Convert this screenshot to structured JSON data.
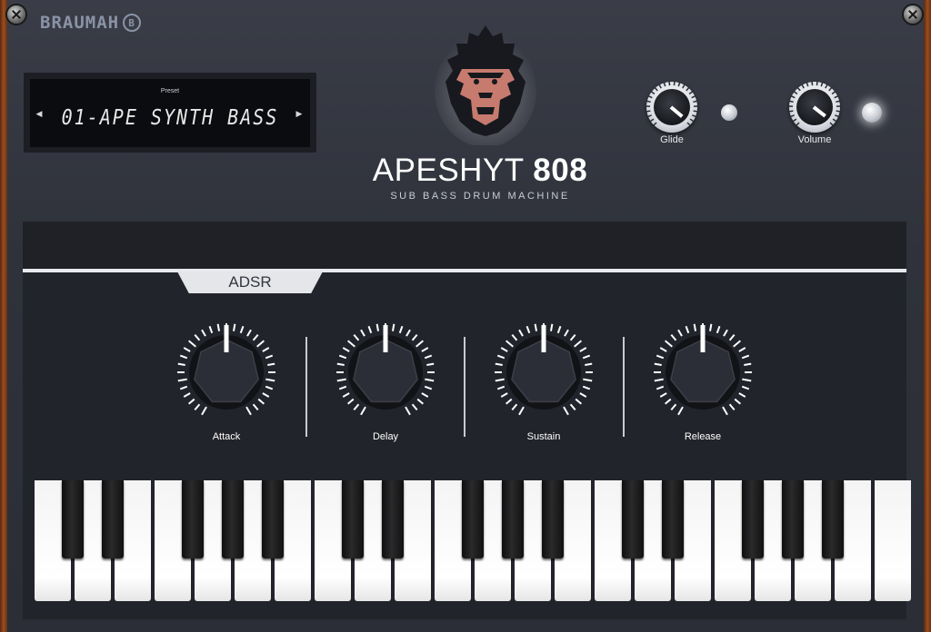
{
  "brand": {
    "name": "BRAUMAH",
    "badge": "B"
  },
  "preset": {
    "label": "Preset",
    "name": "01-APE SYNTH BASS",
    "prev_icon": "triangle-left-icon",
    "next_icon": "triangle-right-icon"
  },
  "product": {
    "title_light": "APESHYT ",
    "title_bold": "808",
    "subtitle": "SUB BASS DRUM MACHINE"
  },
  "header_controls": {
    "glide_label": "Glide",
    "volume_label": "Volume"
  },
  "section": {
    "tab_label": "ADSR"
  },
  "adsr": {
    "knobs": [
      {
        "label": "Attack"
      },
      {
        "label": "Delay"
      },
      {
        "label": "Sustain"
      },
      {
        "label": "Release"
      }
    ]
  },
  "colors": {
    "accent_light": "#e8eaef",
    "logo_face": "#c77a6e",
    "panel_bg": "#22242b"
  }
}
